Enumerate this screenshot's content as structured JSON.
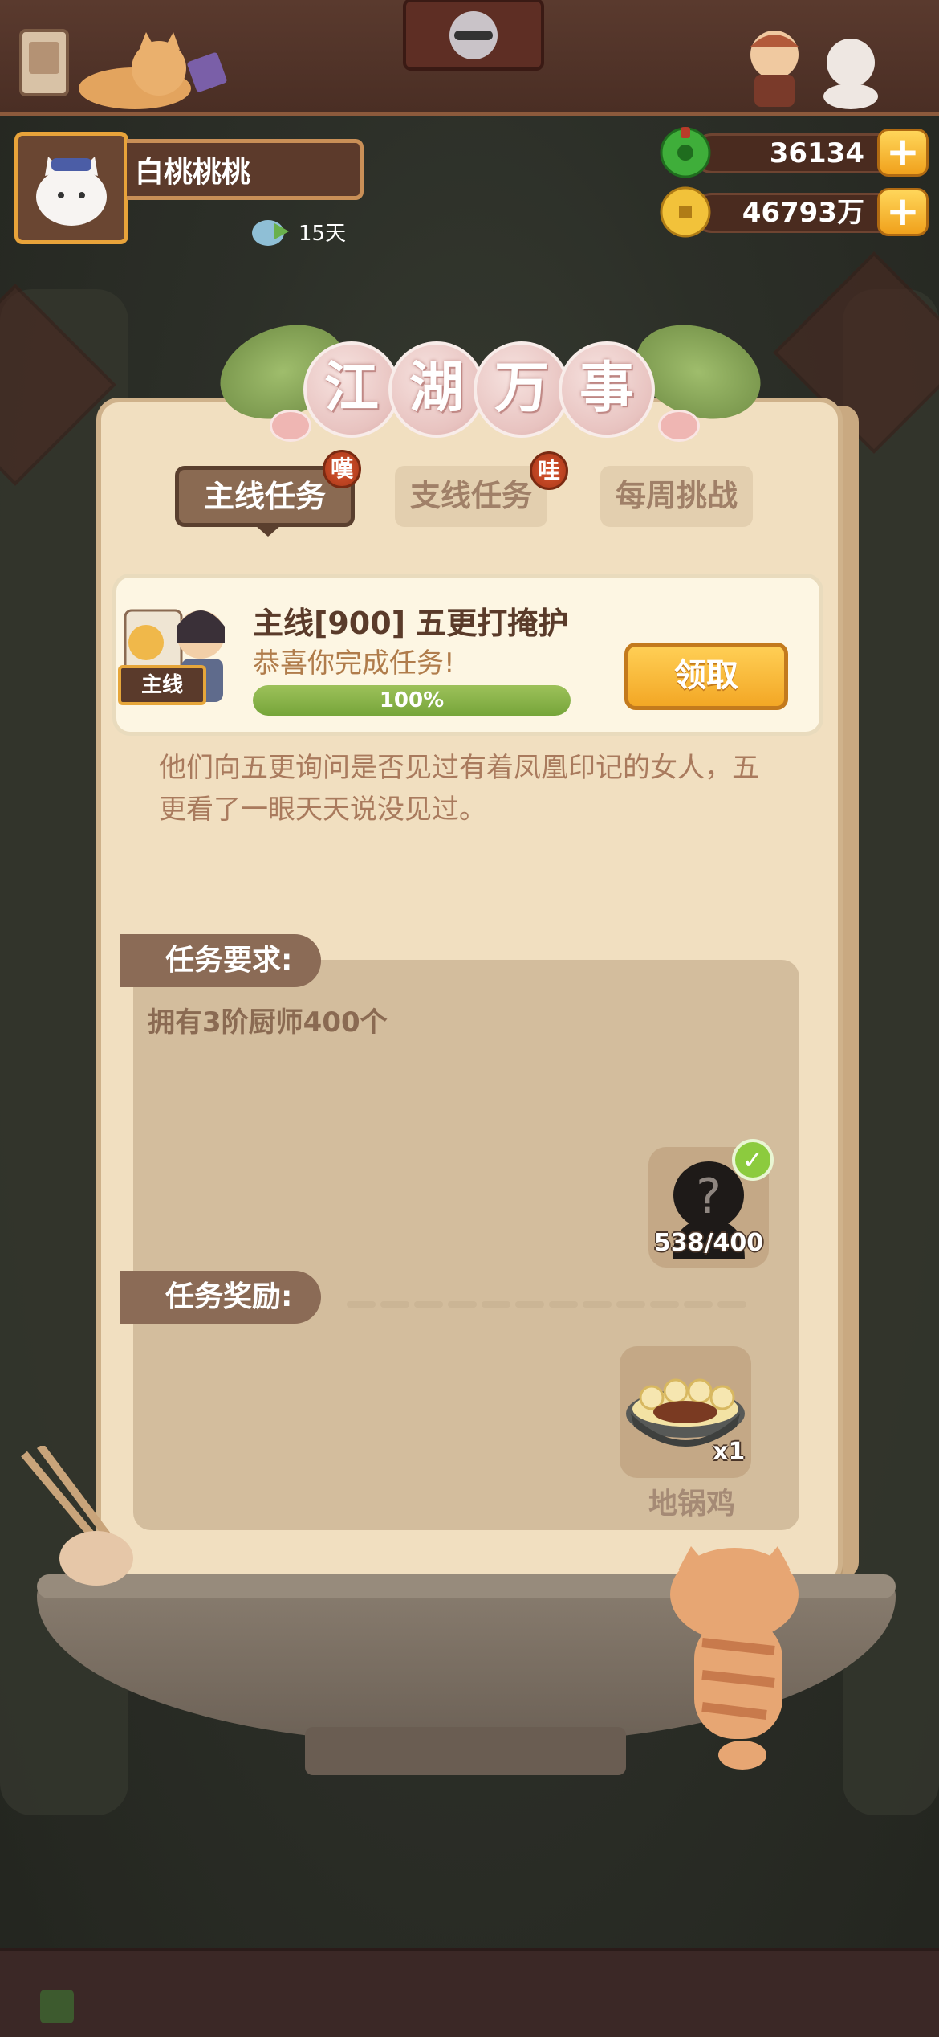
{
  "player": {
    "name": "白桃桃桃",
    "days": "15天"
  },
  "currency": {
    "jade": "36134",
    "coins": "46793万",
    "plus": "+"
  },
  "panel": {
    "title_chars": [
      "江",
      "湖",
      "万",
      "事"
    ],
    "tabs": {
      "main": {
        "label": "主线任务",
        "badge": "嘆"
      },
      "side": {
        "label": "支线任务",
        "badge": "哇"
      },
      "weekly": {
        "label": "每周挑战"
      }
    },
    "quest": {
      "tag": "主线",
      "title": "主线[900] 五更打掩护",
      "status": "恭喜你完成任务!",
      "progress_percent": 100,
      "progress_text": "100%",
      "claim_label": "领取"
    },
    "description": "他们向五更询问是否见过有着凤凰印记的女人，五更看了一眼天天说没见过。",
    "requirements": {
      "label": "任务要求:",
      "text": "拥有3阶厨师400个",
      "item_count": "538/400",
      "item_glyph": "?"
    },
    "rewards": {
      "label": "任务奖励:",
      "item_count": "x1",
      "item_name": "地锅鸡"
    }
  },
  "colors": {
    "panel": "#f1dfc0",
    "tab_active": "#8a6a52",
    "claim_button": "#f3a725",
    "progress": "#76a53a",
    "title_ball": "#e8c3c0"
  }
}
